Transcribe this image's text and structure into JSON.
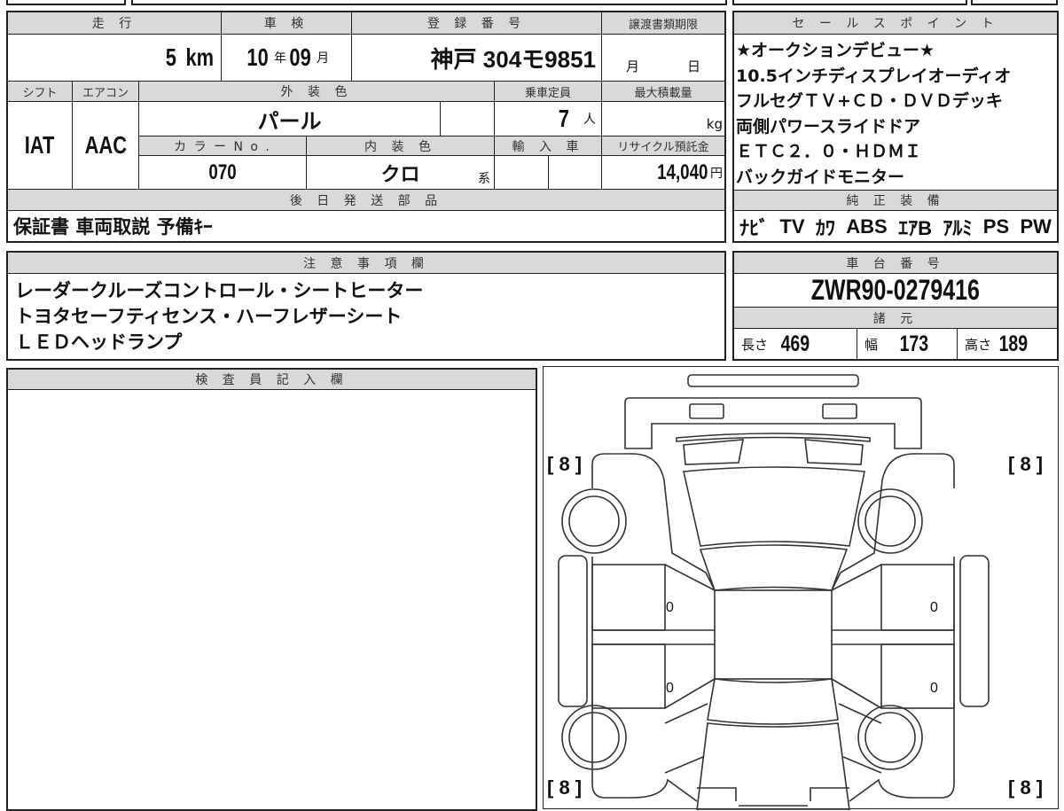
{
  "vehicle_info": {
    "mileage_label": "走 行",
    "mileage_value": "5",
    "mileage_unit": "km",
    "inspection_label": "車 検",
    "inspection_year": "10",
    "inspection_year_unit": "年",
    "inspection_month": "09",
    "inspection_month_unit": "月",
    "registration_label": "登 録 番 号",
    "registration_value": "神戸 304モ9851",
    "transfer_deadline_label": "譲渡書類期限",
    "transfer_month_unit": "月",
    "transfer_day_unit": "日",
    "shift_label": "シフト",
    "shift_value": "IAT",
    "aircon_label": "エアコン",
    "aircon_value": "AAC",
    "exterior_color_label": "外 装 色",
    "exterior_color_value": "パール",
    "capacity_label": "乗車定員",
    "capacity_value": "7",
    "capacity_unit": "人",
    "max_load_label": "最大積載量",
    "max_load_unit": "kg",
    "color_no_label": "カ ラ ー N o .",
    "color_no_value": "070",
    "interior_color_label": "内 装 色",
    "interior_color_value": "クロ",
    "interior_color_unit": "系",
    "import_label": "輸 入 車",
    "recycle_fee_label": "リサイクル預託金",
    "recycle_fee_value": "14,040",
    "recycle_fee_unit": "円",
    "later_parts_label": "後 日 発 送 部 品",
    "later_parts_value": "保証書 車両取説 予備ｷｰ"
  },
  "sales_points": {
    "label": "セ ー ル ス ポ イ ン ト",
    "lines": [
      "★オークションデビュー★",
      "10.5インチディスプレイオーディオ",
      "フルセグＴＶ+ＣＤ・ＤＶＤデッキ",
      "両側パワースライドドア",
      "ＥＴＣ２．０・ＨＤＭＩ",
      "バックガイドモニター"
    ]
  },
  "equipment": {
    "label": "純 正 装 備",
    "items": [
      "ﾅﾋﾞ",
      "TV",
      "ｶﾜ",
      "ABS",
      "ｴｱB",
      "ｱﾙﾐ",
      "PS",
      "PW"
    ]
  },
  "notes": {
    "label": "注 意 事 項 欄",
    "lines": [
      "レーダークルーズコントロール・シートヒーター",
      "トヨタセーフティセンス・ハーフレザーシート",
      "ＬＥＤヘッドランプ"
    ]
  },
  "chassis": {
    "label": "車 台 番 号",
    "value": "ZWR90-0279416",
    "specs_label": "諸 元",
    "length_label": "長さ",
    "length_value": "469",
    "width_label": "幅",
    "width_value": "173",
    "height_label": "高さ",
    "height_value": "189"
  },
  "inspector": {
    "label": "検 査 員 記 入 欄"
  },
  "diagram": {
    "tire_front_left": "[ 8 ]",
    "tire_front_right": "[ 8 ]",
    "tire_rear_left": "[ 8 ]",
    "tire_rear_right": "[ 8 ]",
    "door_marks": [
      "0",
      "0",
      "0",
      "0"
    ]
  }
}
